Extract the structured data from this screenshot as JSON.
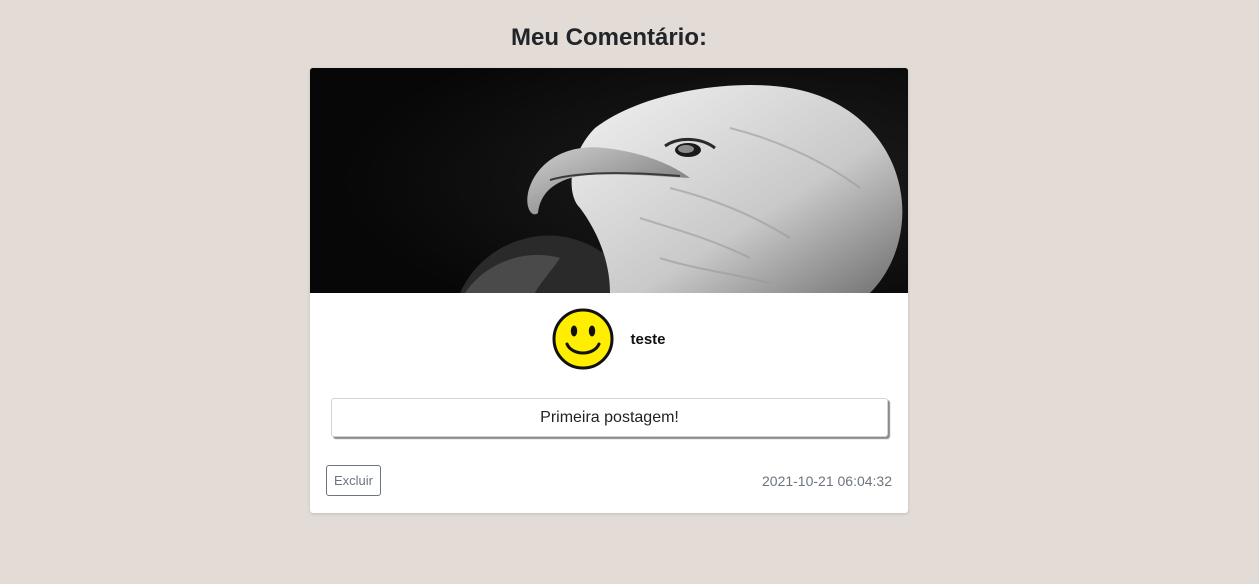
{
  "page": {
    "title": "Meu Comentário:",
    "background": "#e3dcd6"
  },
  "post": {
    "cover_image": "eagle-photo",
    "author": {
      "avatar_icon": "smiley-face-icon",
      "name": "teste"
    },
    "body": "Primeira postagem!",
    "delete_label": "Excluir",
    "timestamp": "2021-10-21 06:04:32"
  },
  "colors": {
    "card": "#ffffff",
    "muted": "#6c757d",
    "avatar_yellow": "#ffee00"
  }
}
